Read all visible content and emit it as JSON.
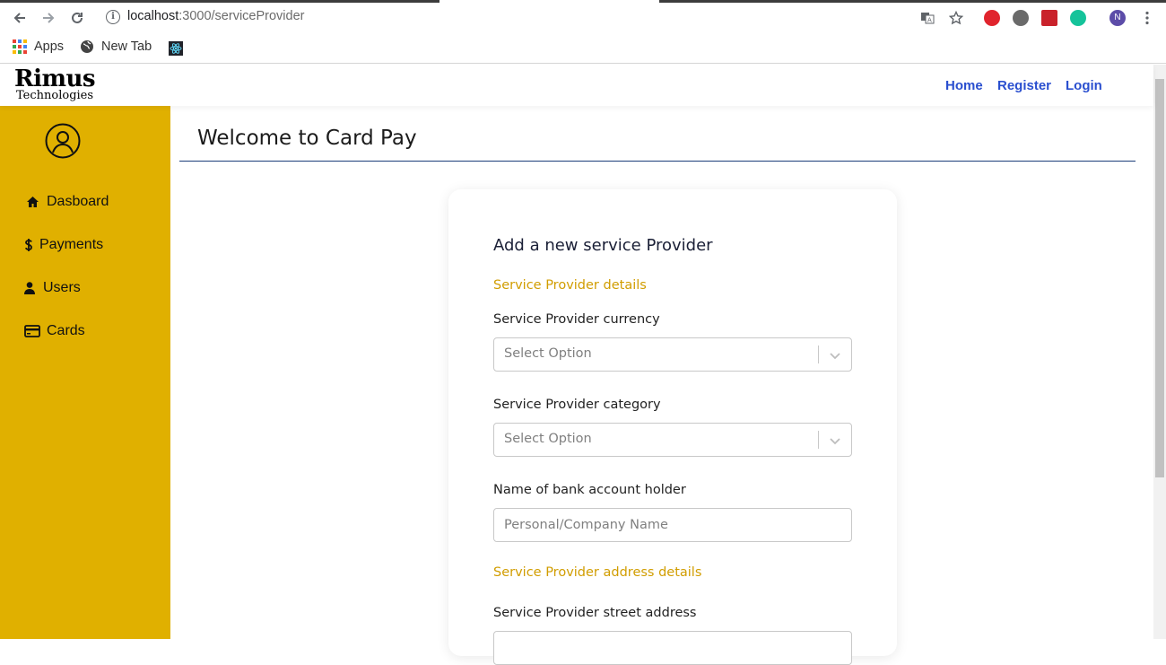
{
  "browser": {
    "url_host": "localhost",
    "url_path": ":3000/serviceProvider",
    "profile_initial": "N",
    "bookmarks": [
      "Apps",
      "New Tab"
    ]
  },
  "header": {
    "logo_main": "Rimus",
    "logo_sub": "Technologies",
    "links": [
      "Home",
      "Register",
      "Login"
    ]
  },
  "sidebar": {
    "items": [
      {
        "label": "Dasboard",
        "icon": "home-icon"
      },
      {
        "label": "Payments",
        "icon": "dollar-icon"
      },
      {
        "label": "Users",
        "icon": "user-icon"
      },
      {
        "label": "Cards",
        "icon": "credit-card-icon"
      }
    ]
  },
  "main": {
    "title": "Welcome to Card Pay"
  },
  "form": {
    "title": "Add a new service Provider",
    "section_details": "Service Provider details",
    "currency_label": "Service Provider currency",
    "currency_placeholder": "Select Option",
    "category_label": "Service Provider category",
    "category_placeholder": "Select Option",
    "holder_label": "Name of bank account holder",
    "holder_placeholder": "Personal/Company Name",
    "section_address": "Service Provider address details",
    "street_label": "Service Provider street address"
  },
  "colors": {
    "sidebar": "#e0b000",
    "accent_section": "#d19d00",
    "link": "#2a4fcf"
  }
}
